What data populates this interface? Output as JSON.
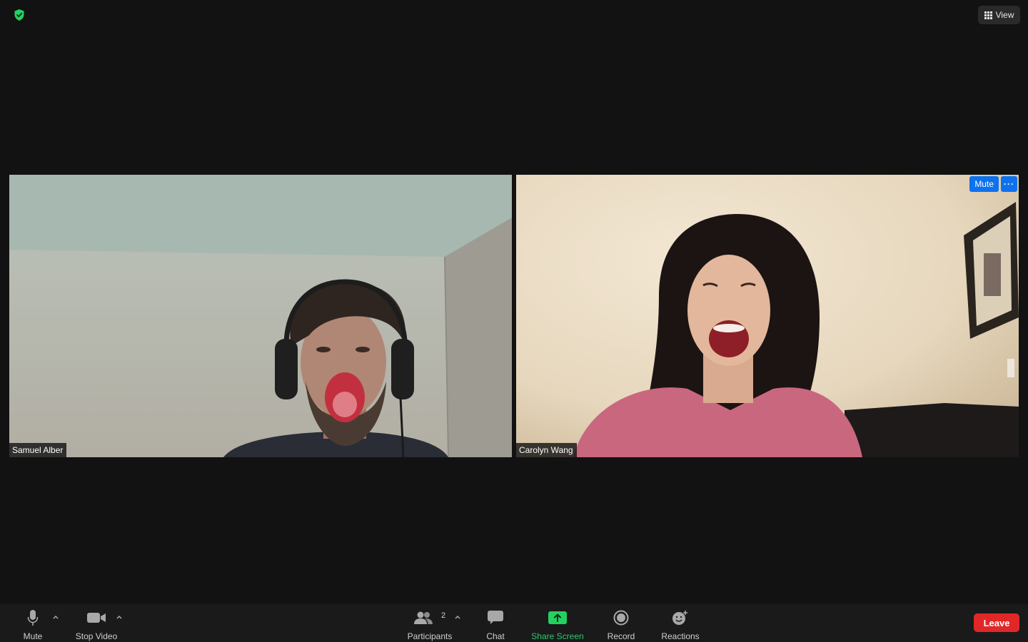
{
  "app": {
    "security_icon": "shield-check-icon",
    "security_color": "#23d160"
  },
  "view_button": {
    "label": "View",
    "icon": "grid-icon"
  },
  "participants": [
    {
      "name": "Samuel Alber",
      "image": "person-wearing-headphones-yawning"
    },
    {
      "name": "Carolyn Wang",
      "image": "person-laughing-in-pink-sweater",
      "mute_label": "Mute",
      "more_icon": "ellipsis-icon",
      "more_label": "···",
      "accent": "#0e72ed"
    }
  ],
  "toolbar": {
    "mute": {
      "label": "Mute",
      "icon": "microphone-icon"
    },
    "stop_video": {
      "label": "Stop Video",
      "icon": "video-camera-icon"
    },
    "participants": {
      "label": "Participants",
      "count": "2",
      "icon": "people-icon"
    },
    "chat": {
      "label": "Chat",
      "icon": "chat-bubble-icon"
    },
    "share_screen": {
      "label": "Share Screen",
      "icon": "share-screen-icon",
      "color": "#2dc76d"
    },
    "record": {
      "label": "Record",
      "icon": "record-icon"
    },
    "reactions": {
      "label": "Reactions",
      "icon": "emoji-add-icon"
    },
    "leave": {
      "label": "Leave",
      "color": "#e02828"
    }
  }
}
